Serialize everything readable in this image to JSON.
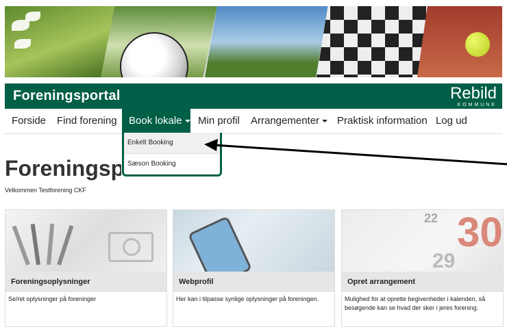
{
  "header": {
    "title": "Foreningsportal",
    "logo_name": "Rebild",
    "logo_sub": "KOMMUNE"
  },
  "nav": {
    "items": [
      {
        "label": "Forside",
        "caret": false
      },
      {
        "label": "Find forening",
        "caret": false
      },
      {
        "label": "Book lokale",
        "caret": true,
        "active": true
      },
      {
        "label": "Min profil",
        "caret": false
      },
      {
        "label": "Arrangementer",
        "caret": true
      },
      {
        "label": "Praktisk information",
        "caret": false
      },
      {
        "label": "Log ud",
        "caret": false
      }
    ],
    "dropdown": [
      "Enkelt Booking",
      "Sæson Booking"
    ]
  },
  "main": {
    "title": "Foreningsp",
    "welcome": "Velkommen Testforening CKF"
  },
  "cards": [
    {
      "title": "Foreningsoplysninger",
      "text": "Se/ret oplysninger på foreninger"
    },
    {
      "title": "Webprofil",
      "text": "Her kan i tilpasse synlige oplysninger på foreningen."
    },
    {
      "title": "Opret arrangement",
      "text": "Mulighed for at oprette begivenheder i kalenden, så besøgende kan se hvad der sker i jeres forening."
    }
  ],
  "calendar": {
    "numbers": [
      "22",
      "30",
      "29"
    ]
  },
  "colors": {
    "brand": "#005f46",
    "card_bar": "#e6e6e6"
  }
}
